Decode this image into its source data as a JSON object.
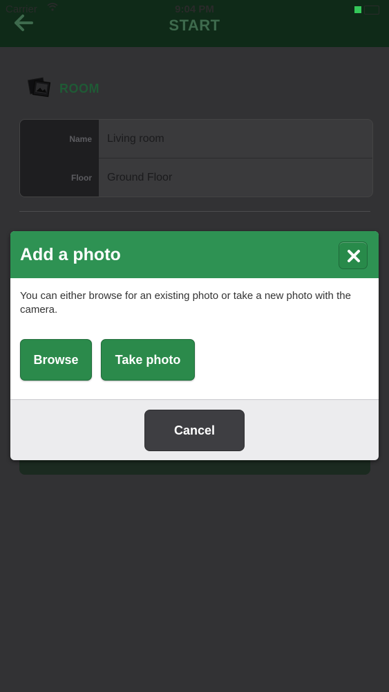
{
  "status_bar": {
    "carrier": "Carrier",
    "time": "9:04 PM"
  },
  "navbar": {
    "title": "START",
    "back_icon": "back-arrow-icon"
  },
  "section": {
    "title": "ROOM",
    "icon": "photos-icon"
  },
  "form": {
    "rows": [
      {
        "label": "Name",
        "value": "Living room"
      },
      {
        "label": "Floor",
        "value": "Ground Floor"
      }
    ]
  },
  "modal": {
    "title": "Add a photo",
    "description": "You can either browse for an existing photo or take a new photo with the camera.",
    "browse_label": "Browse",
    "take_photo_label": "Take photo",
    "cancel_label": "Cancel",
    "close_icon": "close-icon"
  },
  "colors": {
    "accent_green": "#2e9253",
    "overlay_dark": "#323234",
    "cancel_button": "#3e3e42"
  }
}
